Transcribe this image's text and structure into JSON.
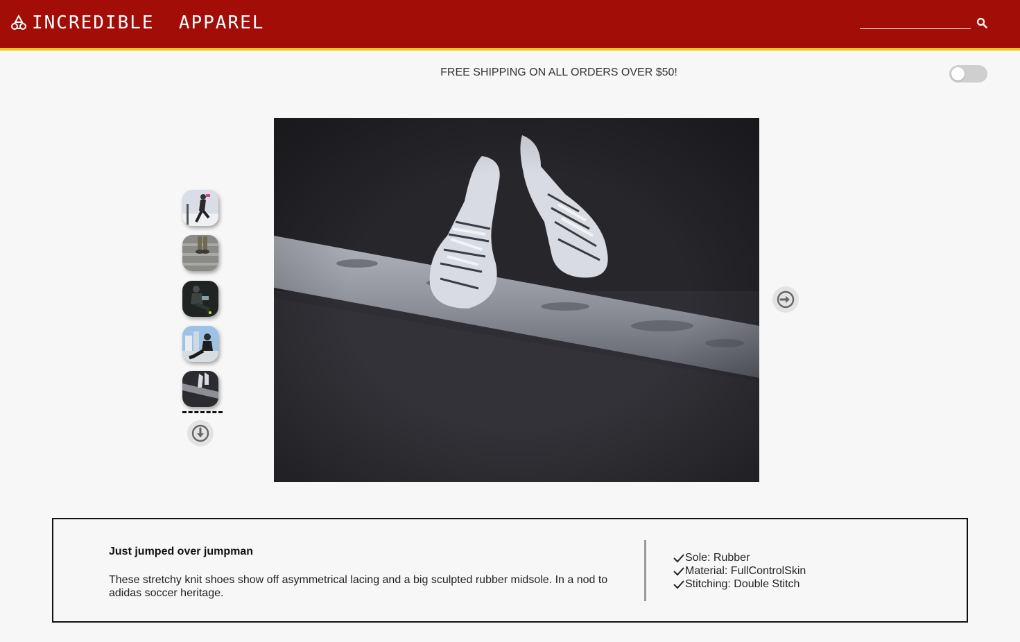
{
  "header": {
    "brand": "INCREDIBLE  APPAREL",
    "search_placeholder": "",
    "accent_color": "#a20d07",
    "stripe_color": "#f5c518"
  },
  "promo": {
    "shipping_text": "FREE SHIPPING ON ALL ORDERS OVER $50!"
  },
  "theme_toggle": {
    "on": false
  },
  "gallery": {
    "thumbnails": [
      {
        "icon": "thumbnail-person-kicking"
      },
      {
        "icon": "thumbnail-shoes-on-stairs"
      },
      {
        "icon": "thumbnail-person-sitting-dark"
      },
      {
        "icon": "thumbnail-person-sitting-city"
      },
      {
        "icon": "thumbnail-shoes-dangling"
      }
    ],
    "selected_index": 4
  },
  "product": {
    "title": "Just jumped over jumpman",
    "description": "These stretchy knit shoes show off asymmetrical lacing and a big sculpted rubber midsole. In a nod to adidas soccer heritage.",
    "features": [
      "Sole: Rubber",
      "Material: FullControlSkin",
      "Stitching: Double Stitch"
    ]
  }
}
